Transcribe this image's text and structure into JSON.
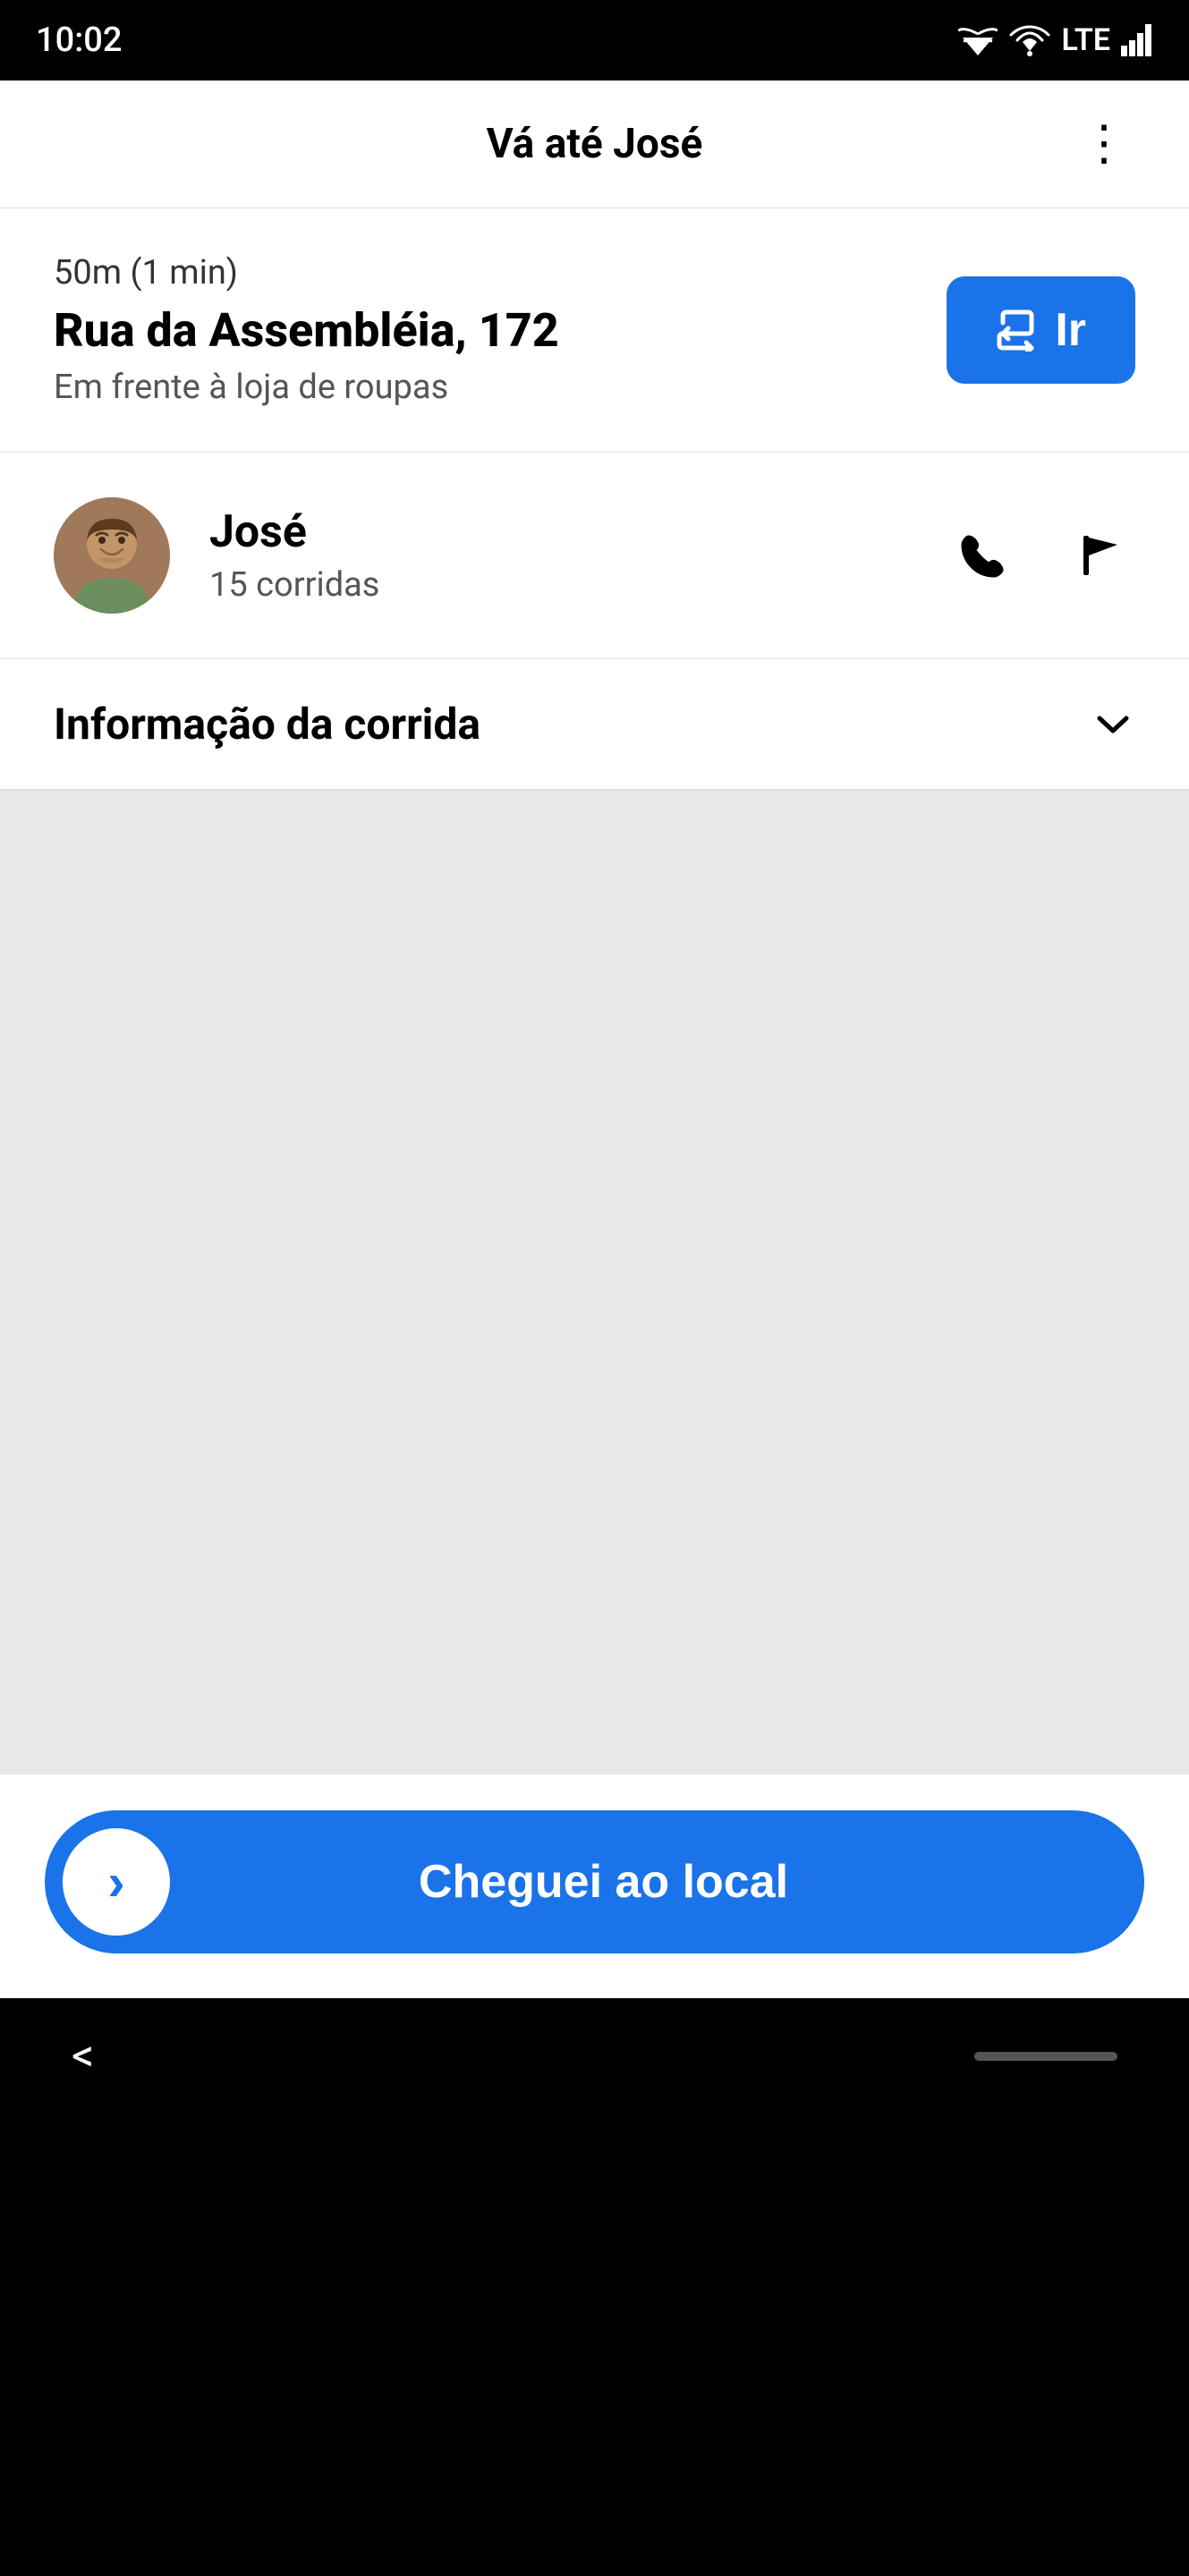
{
  "statusBar": {
    "time": "10:02",
    "lte": "LTE"
  },
  "header": {
    "title": "Vá até José",
    "menuLabel": "⋮"
  },
  "addressSection": {
    "distanceTime": "50m (1 min)",
    "streetName": "Rua da Assembléia, 172",
    "locationHint": "Em frente à loja de roupas",
    "goButtonLabel": "Ir"
  },
  "riderSection": {
    "name": "José",
    "trips": "15 corridas"
  },
  "tripInfo": {
    "label": "Informação da corrida"
  },
  "bottomButton": {
    "label": "Cheguei ao local"
  },
  "nav": {
    "back": "<"
  }
}
